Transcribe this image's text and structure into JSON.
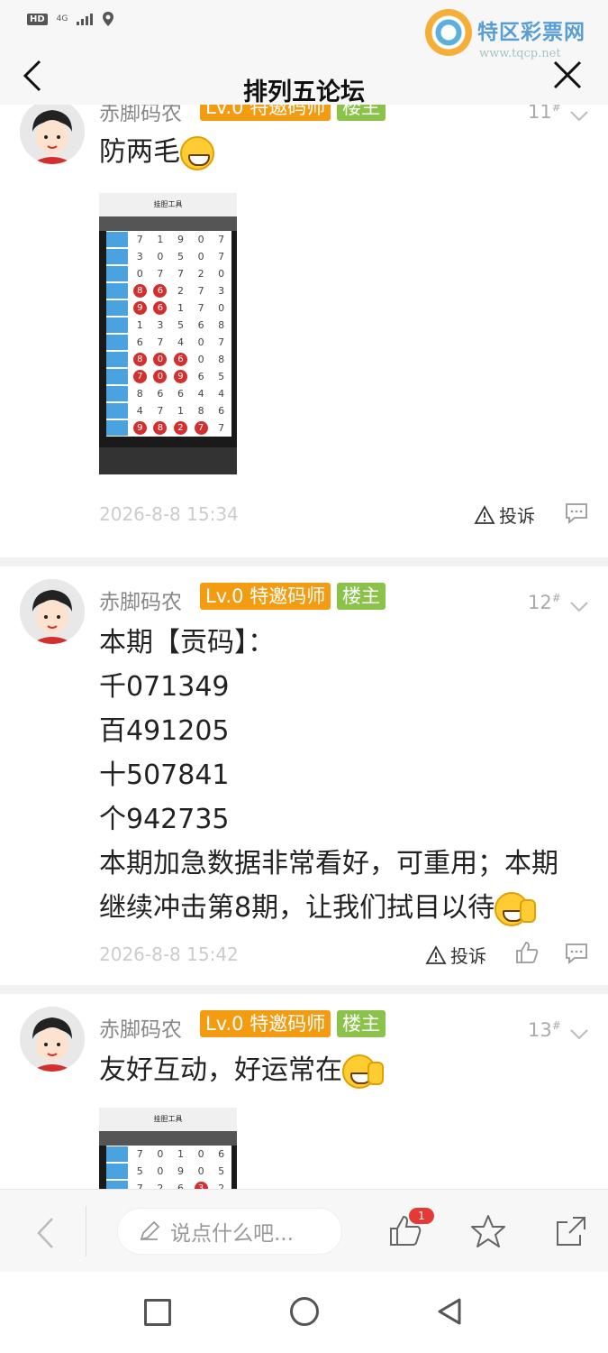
{
  "status_bar": {
    "hd": "HD",
    "network": "4G"
  },
  "watermark": {
    "title": "特区彩票网",
    "url": "www.tqcp.net"
  },
  "header": {
    "title": "排列五论坛"
  },
  "posts": [
    {
      "user": "赤脚码农",
      "level": "Lv.0 特邀码师",
      "role": "楼主",
      "floor": "11",
      "floor_mark": "#",
      "text": "防两毛",
      "time": "2026-8-8 15:34",
      "report": "投诉",
      "image": {
        "title": "挂胆工具",
        "rows": [
          [
            "7",
            "1",
            "9",
            "0",
            "7"
          ],
          [
            "3",
            "0",
            "5",
            "0",
            "7"
          ],
          [
            "0",
            "7",
            "7",
            "2",
            "0"
          ],
          [
            "8",
            "6",
            "2",
            "7",
            "3"
          ],
          [
            "9",
            "6",
            "1",
            "7",
            "0"
          ],
          [
            "1",
            "3",
            "5",
            "6",
            "8"
          ],
          [
            "6",
            "7",
            "4",
            "0",
            "7"
          ],
          [
            "8",
            "0",
            "6",
            "0",
            "8"
          ],
          [
            "7",
            "0",
            "9",
            "6",
            "5"
          ],
          [
            "8",
            "6",
            "6",
            "4",
            "4"
          ],
          [
            "4",
            "7",
            "1",
            "8",
            "6"
          ],
          [
            "9",
            "8",
            "2",
            "7",
            "7"
          ]
        ]
      }
    },
    {
      "user": "赤脚码农",
      "level": "Lv.0 特邀码师",
      "role": "楼主",
      "floor": "12",
      "floor_mark": "#",
      "lines": [
        "本期【贡码】：",
        "千071349",
        "百491205",
        "十507841",
        "个942735",
        "本期加急数据非常看好，可重用；本期",
        "继续冲击第8期，让我们拭目以待"
      ],
      "time": "2026-8-8 15:42",
      "report": "投诉"
    },
    {
      "user": "赤脚码农",
      "level": "Lv.0 特邀码师",
      "role": "楼主",
      "floor": "13",
      "floor_mark": "#",
      "text": "友好互动，好运常在",
      "image": {
        "title": "挂胆工具",
        "rows": [
          [
            "7",
            "0",
            "1",
            "0",
            "6"
          ],
          [
            "5",
            "0",
            "9",
            "0",
            "5"
          ],
          [
            "7",
            "2",
            "6",
            "3",
            "2"
          ]
        ]
      }
    }
  ],
  "bottom_bar": {
    "input_placeholder": "说点什么吧...",
    "like_count": "1"
  },
  "icons": {
    "back": "chevron-left-icon",
    "close": "close-icon",
    "report": "warning-icon",
    "comment": "comment-icon",
    "like": "thumbs-up-icon",
    "star": "star-icon",
    "share": "share-icon",
    "edit": "pencil-icon"
  },
  "colors": {
    "level_badge": "#f39c12",
    "owner_badge": "#8bc34a",
    "like_badge": "#e53935"
  }
}
